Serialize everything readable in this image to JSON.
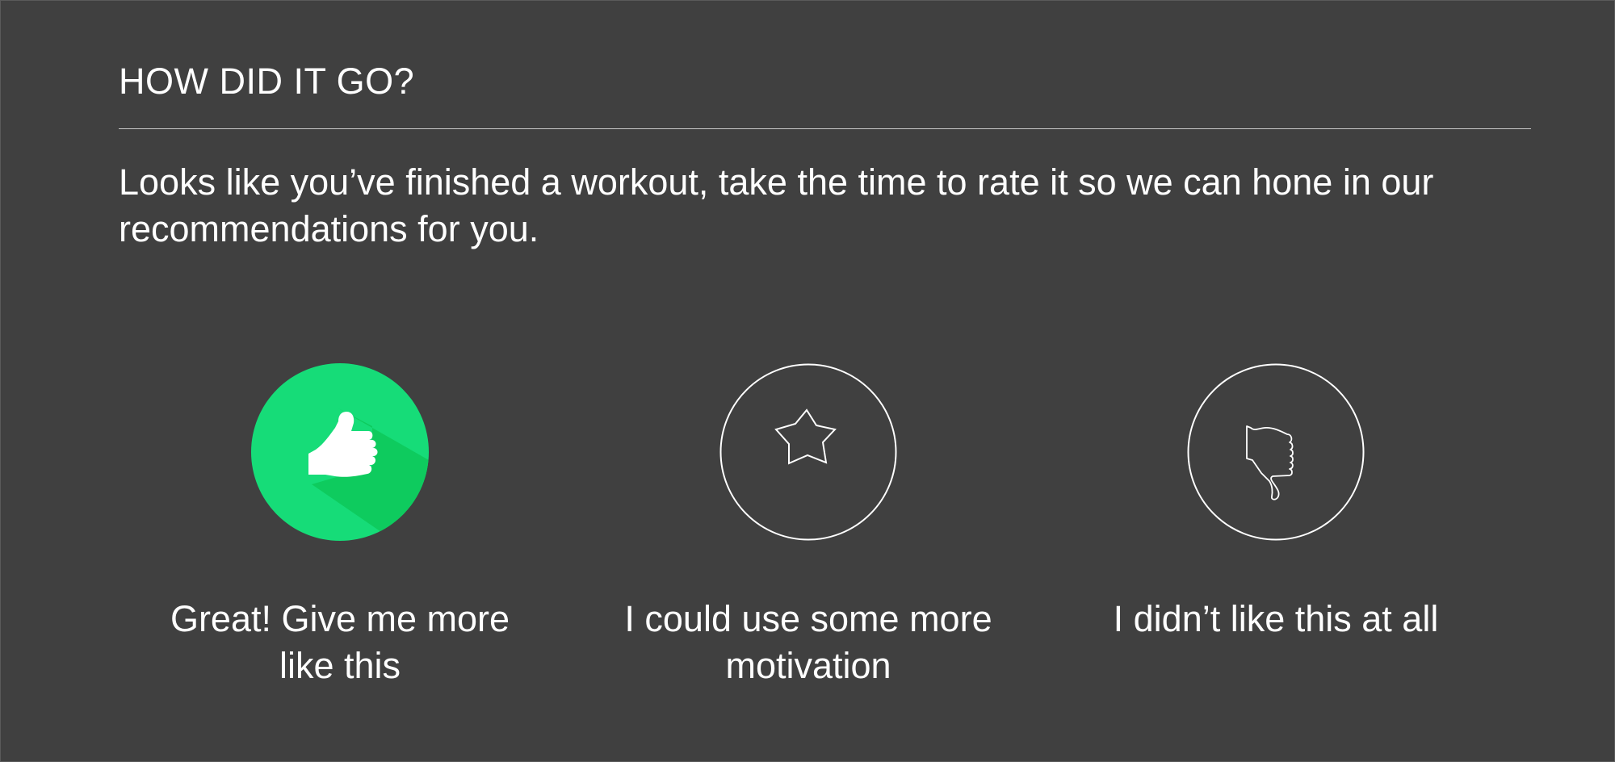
{
  "header": {
    "title": "HOW DID IT GO?"
  },
  "intro": {
    "text": "Looks like you’ve finished a workout, take the time to rate it so we can hone in our recommendations for you."
  },
  "options": [
    {
      "label": "Great! Give me more like this",
      "icon": "thumbs-up-icon",
      "selected": true
    },
    {
      "label": "I could use some more motivation",
      "icon": "star-icon",
      "selected": false
    },
    {
      "label": "I didn’t like this at all",
      "icon": "thumbs-down-icon",
      "selected": false
    }
  ],
  "colors": {
    "background": "#404040",
    "accent": "#16dc78",
    "accent_shadow": "#0ecb5e",
    "text": "#ffffff"
  }
}
